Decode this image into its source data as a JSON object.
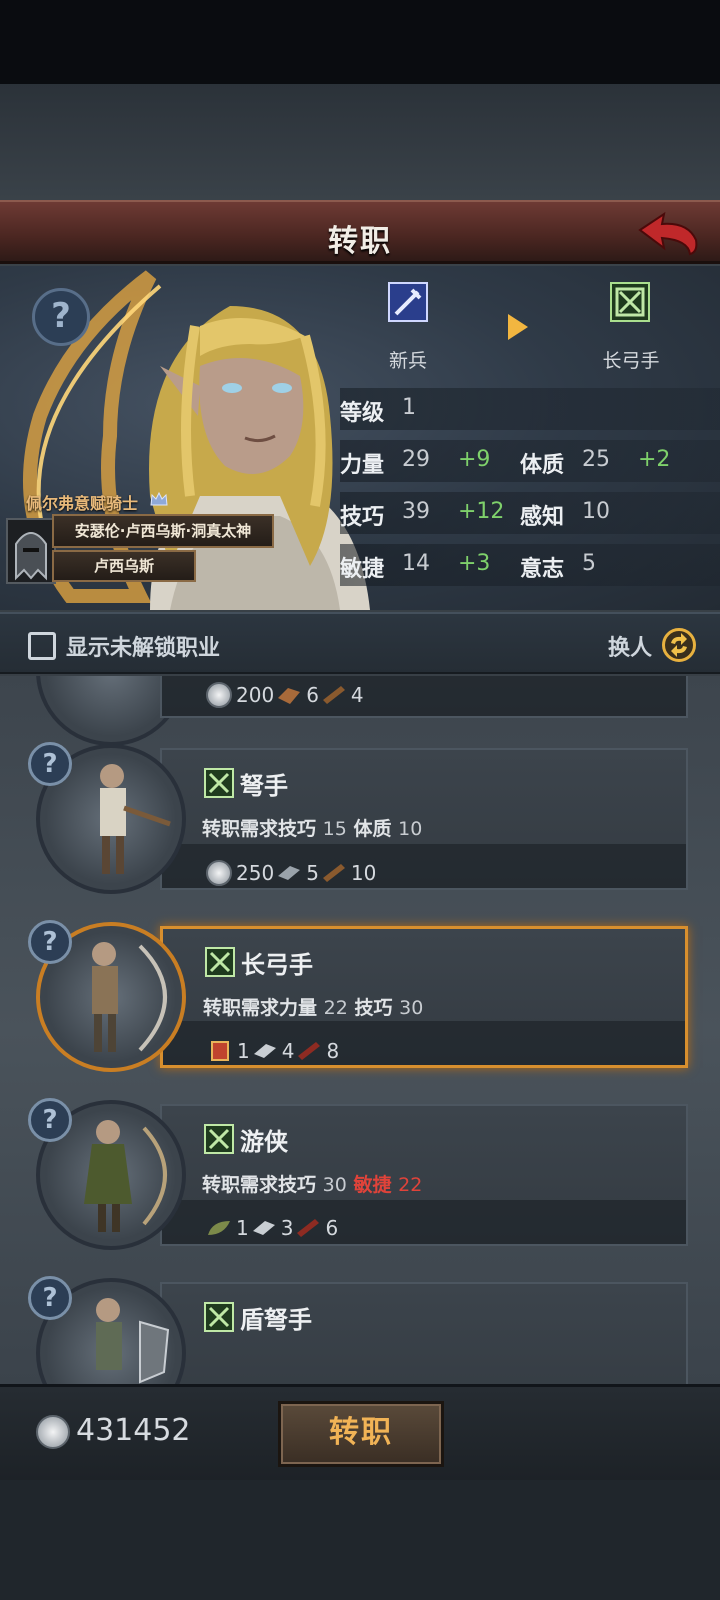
{
  "header": {
    "title": "转职"
  },
  "character": {
    "title": "佩尔弗意赋骑士",
    "full_name": "安瑟伦·卢西乌斯·洞真太神",
    "short_name": "卢西乌斯"
  },
  "class_change": {
    "from": "新兵",
    "to": "长弓手"
  },
  "stats": {
    "level": {
      "label": "等级",
      "value": "1"
    },
    "strength": {
      "label": "力量",
      "value": "29",
      "bonus": "+9"
    },
    "constitution": {
      "label": "体质",
      "value": "25",
      "bonus": "+2"
    },
    "skill": {
      "label": "技巧",
      "value": "39",
      "bonus": "+12"
    },
    "perception": {
      "label": "感知",
      "value": "10"
    },
    "agility": {
      "label": "敏捷",
      "value": "14",
      "bonus": "+3"
    },
    "will": {
      "label": "意志",
      "value": "5"
    }
  },
  "toolbar": {
    "show_locked_label": "显示未解锁职业",
    "swap_label": "换人"
  },
  "classes": [
    {
      "name": "",
      "req_prefix": "",
      "costs": [
        "200",
        "6",
        "4"
      ]
    },
    {
      "name": "弩手",
      "req_prefix": "转职需求",
      "req1_label": "技巧",
      "req1_value": "15",
      "req2_label": "体质",
      "req2_value": "10",
      "costs": [
        "250",
        "5",
        "10"
      ]
    },
    {
      "name": "长弓手",
      "req_prefix": "转职需求",
      "req1_label": "力量",
      "req1_value": "22",
      "req2_label": "技巧",
      "req2_value": "30",
      "costs": [
        "1",
        "4",
        "8"
      ]
    },
    {
      "name": "游侠",
      "req_prefix": "转职需求",
      "req1_label": "技巧",
      "req1_value": "30",
      "req2_label": "敏捷",
      "req2_value": "22",
      "costs": [
        "1",
        "3",
        "6"
      ]
    },
    {
      "name": "盾弩手"
    }
  ],
  "footer": {
    "coins": "431452",
    "confirm_label": "转职"
  },
  "colors": {
    "accent": "#f1b356",
    "bonus_green": "#7fd16b",
    "unmet_red": "#e0433a",
    "selected_border": "#d88f2e"
  }
}
